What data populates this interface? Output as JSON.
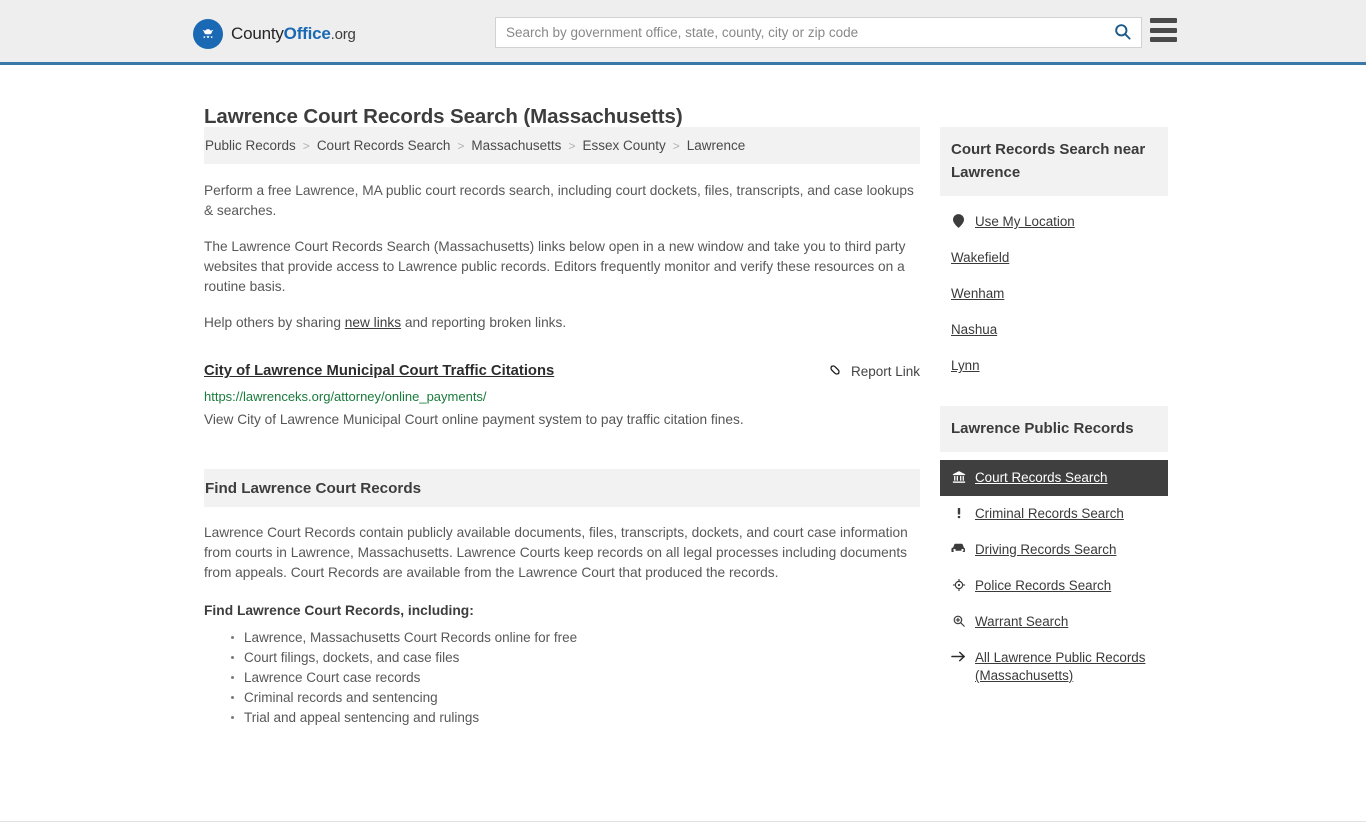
{
  "header": {
    "logo": {
      "text_a": "County",
      "text_b": "Office",
      "text_c": ".org",
      "icon": "eagle-badge-icon"
    },
    "search": {
      "placeholder": "Search by government office, state, county, city or zip code",
      "value": "",
      "button_icon": "search-icon"
    },
    "menu_icon": "hamburger-menu-icon",
    "accent_color": "#3a78a8",
    "background_color": "#eeeeee"
  },
  "page": {
    "title": "Lawrence Court Records Search (Massachusetts)"
  },
  "breadcrumb": {
    "separator": ">",
    "items": [
      {
        "label": "Public Records"
      },
      {
        "label": "Court Records Search"
      },
      {
        "label": "Massachusetts"
      },
      {
        "label": "Essex County"
      },
      {
        "label": "Lawrence"
      }
    ]
  },
  "intro": {
    "p1": "Perform a free Lawrence, MA public court records search, including court dockets, files, transcripts, and case lookups & searches.",
    "p2": "The Lawrence Court Records Search (Massachusetts) links below open in a new window and take you to third party websites that provide access to Lawrence public records. Editors frequently monitor and verify these resources on a routine basis.",
    "p3_before": "Help others by sharing ",
    "p3_link": "new links",
    "p3_after": " and reporting broken links."
  },
  "results": [
    {
      "title": "City of Lawrence Municipal Court Traffic Citations",
      "url": "https://lawrenceks.org/attorney/online_payments/",
      "description": "View City of Lawrence Municipal Court online payment system to pay traffic citation fines.",
      "report_label": "Report Link",
      "report_icon": "broken-link-icon",
      "url_color": "#1a7a3c"
    }
  ],
  "section": {
    "heading": "Find Lawrence Court Records",
    "body": "Lawrence Court Records contain publicly available documents, files, transcripts, dockets, and court case information from courts in Lawrence, Massachusetts. Lawrence Courts keep records on all legal processes including documents from appeals. Court Records are available from the Lawrence Court that produced the records.",
    "list_heading": "Find Lawrence Court Records, including:",
    "list_items": [
      "Lawrence, Massachusetts Court Records online for free",
      "Court filings, dockets, and case files",
      "Lawrence Court case records",
      "Criminal records and sentencing",
      "Trial and appeal sentencing and rulings"
    ]
  },
  "sidebar": {
    "nearby": {
      "title": "Court Records Search near Lawrence",
      "items": [
        {
          "label": "Use My Location",
          "icon": "map-pin-icon"
        },
        {
          "label": "Wakefield",
          "icon": ""
        },
        {
          "label": "Wenham",
          "icon": ""
        },
        {
          "label": "Nashua",
          "icon": ""
        },
        {
          "label": "Lynn",
          "icon": ""
        }
      ]
    },
    "public_records": {
      "title": "Lawrence Public Records",
      "active_background": "#3f3f3f",
      "items": [
        {
          "label": "Court Records Search",
          "icon": "courthouse-icon",
          "active": true
        },
        {
          "label": "Criminal Records Search",
          "icon": "exclamation-icon",
          "active": false
        },
        {
          "label": "Driving Records Search",
          "icon": "car-icon",
          "active": false
        },
        {
          "label": "Police Records Search",
          "icon": "police-badge-icon",
          "active": false
        },
        {
          "label": "Warrant Search",
          "icon": "magnifier-plus-icon",
          "active": false
        },
        {
          "label": "All Lawrence Public Records (Massachusetts)",
          "icon": "arrow-right-icon",
          "active": false
        }
      ]
    }
  }
}
